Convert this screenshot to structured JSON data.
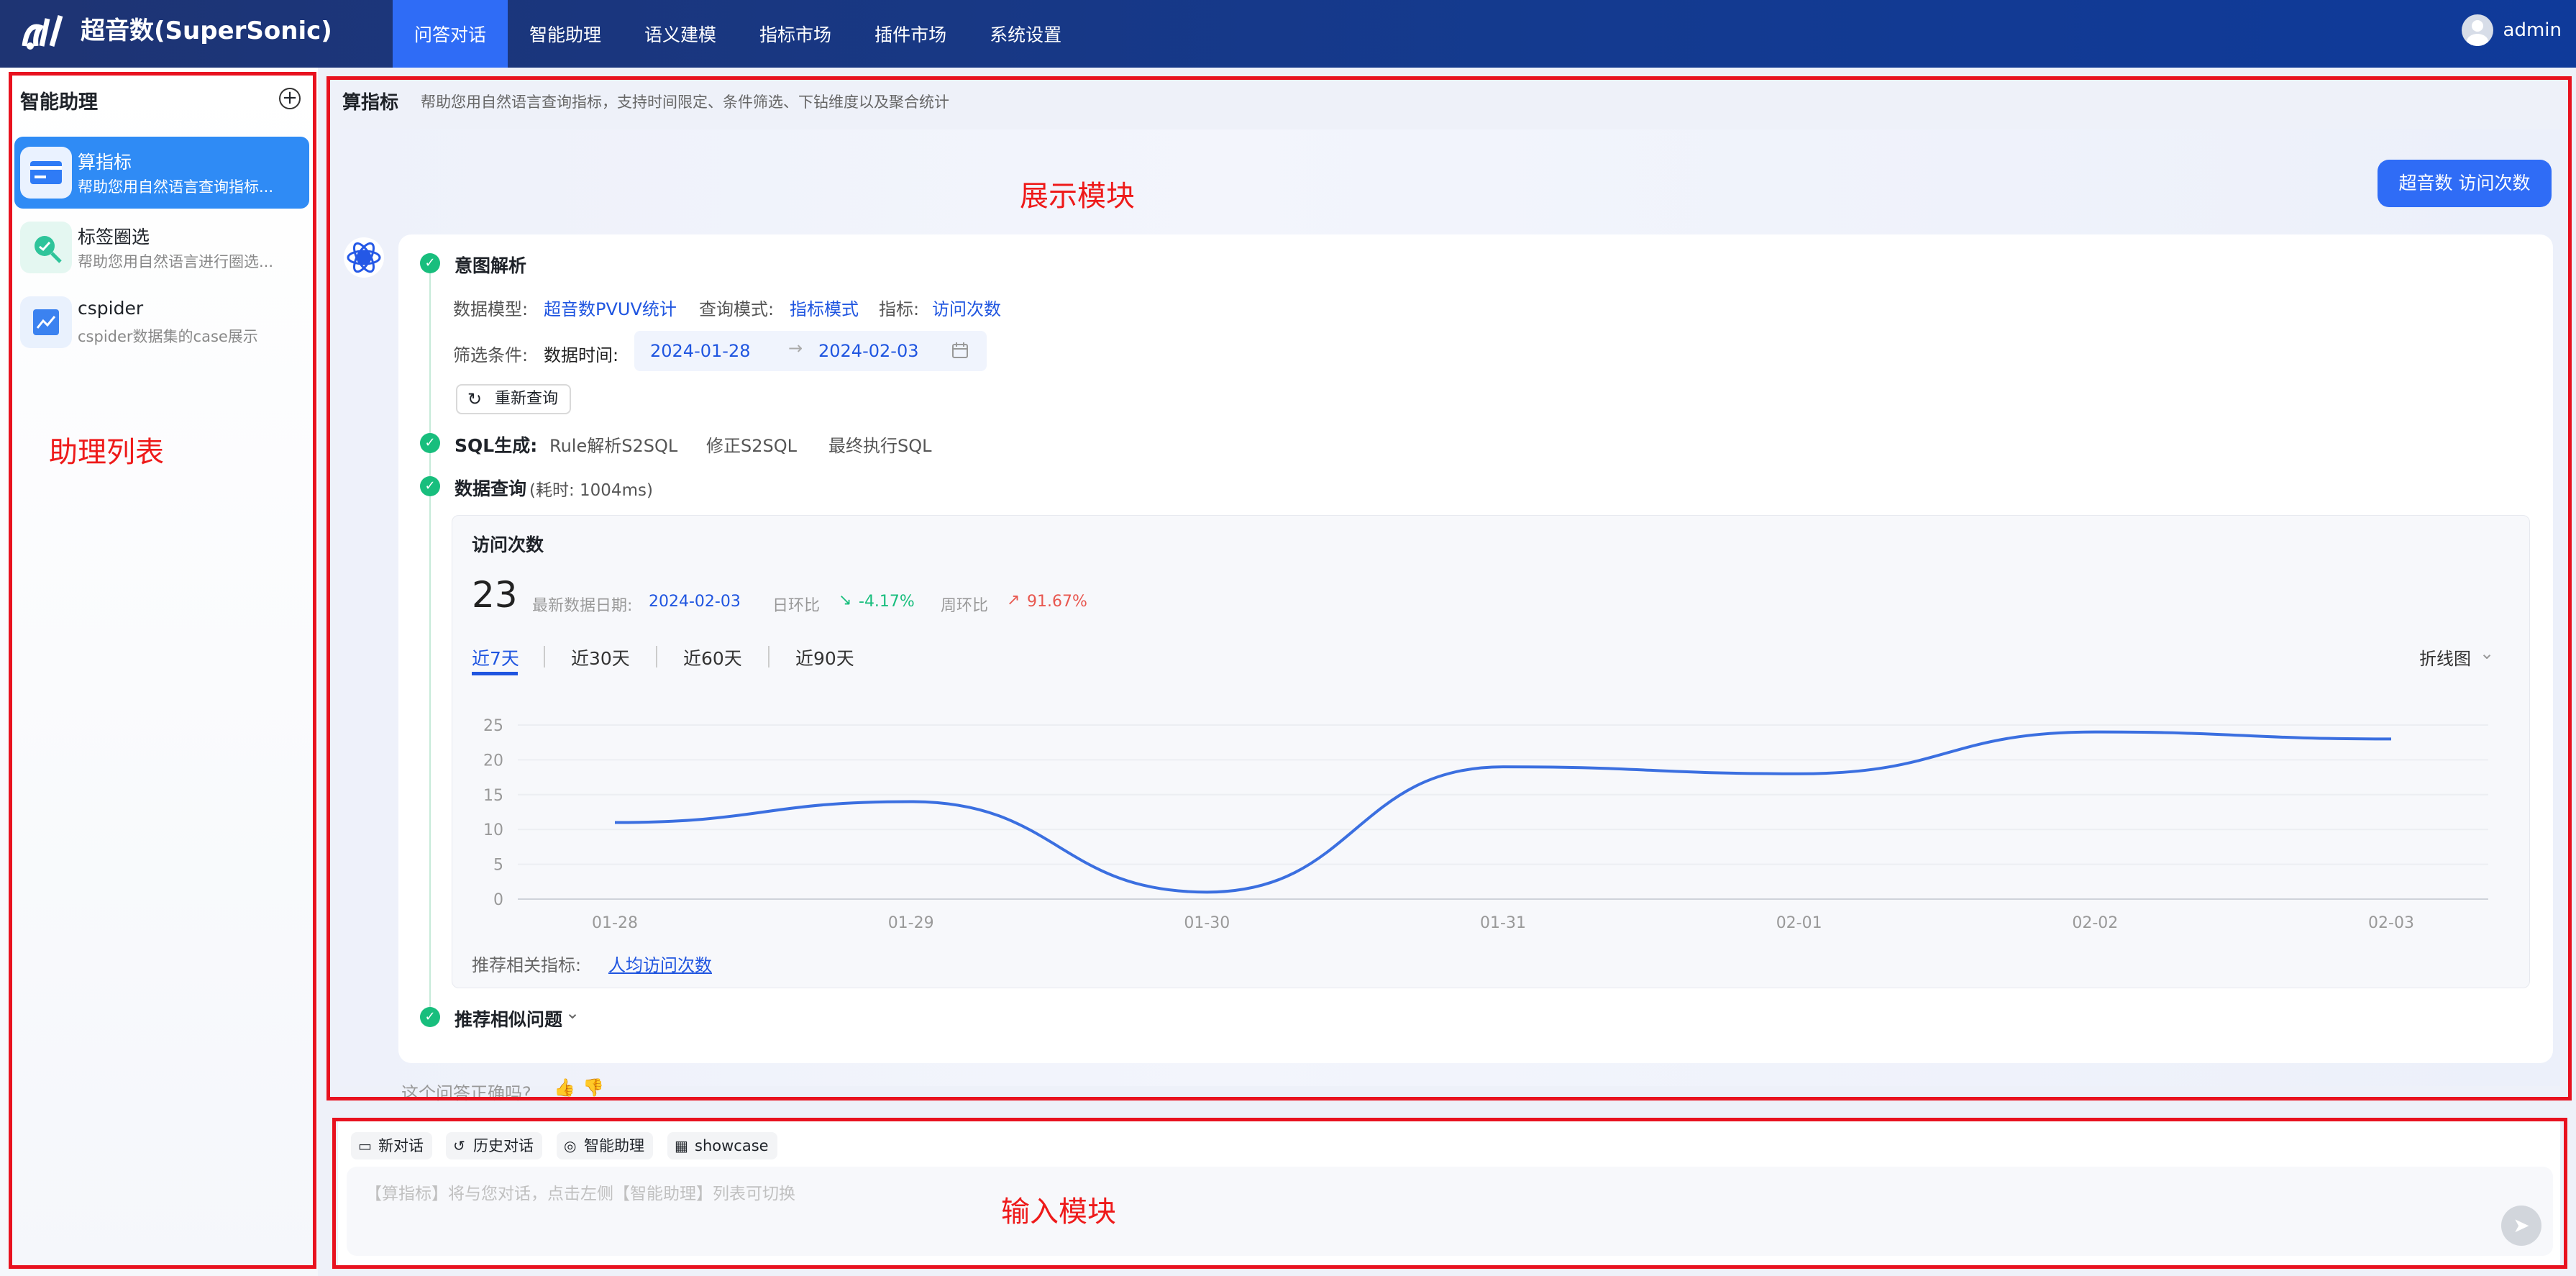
{
  "brand": "超音数(SuperSonic)",
  "nav": [
    "问答对话",
    "智能助理",
    "语义建模",
    "指标市场",
    "插件市场",
    "系统设置"
  ],
  "user": "admin",
  "sidebar": {
    "title": "智能助理",
    "agents": [
      {
        "name": "算指标",
        "desc": "帮助您用自然语言查询指标..."
      },
      {
        "name": "标签圈选",
        "desc": "帮助您用自然语言进行圈选..."
      },
      {
        "name": "cspider",
        "desc": "cspider数据集的case展示"
      }
    ]
  },
  "annotations": {
    "list": "助理列表",
    "display": "展示模块",
    "input": "输入模块"
  },
  "header": {
    "title": "算指标",
    "desc": "帮助您用自然语言查询指标，支持时间限定、条件筛选、下钻维度以及聚合统计"
  },
  "top_button": "超音数 访问次数",
  "intent": {
    "title": "意图解析",
    "model_label": "数据模型:",
    "model": "超音数PVUV统计",
    "mode_label": "查询模式:",
    "mode": "指标模式",
    "metric_label": "指标:",
    "metric": "访问次数",
    "filter_label": "筛选条件:",
    "time_label": "数据时间:",
    "date_start": "2024-01-28",
    "date_end": "2024-02-03",
    "refresh": "重新查询"
  },
  "sql": {
    "title": "SQL生成:",
    "items": [
      "Rule解析S2SQL",
      "修正S2SQL",
      "最终执行SQL"
    ]
  },
  "query": {
    "title": "数据查询",
    "time": "(耗时: 1004ms)"
  },
  "metric_card": {
    "title": "访问次数",
    "value": "23",
    "date_label": "最新数据日期:",
    "date": "2024-02-03",
    "day_label": "日环比",
    "day_change": "-4.17%",
    "week_label": "周环比",
    "week_change": "91.67%",
    "tabs": [
      "近7天",
      "近30天",
      "近60天",
      "近90天"
    ],
    "chart_type": "折线图",
    "related_label": "推荐相关指标:",
    "related": "人均访问次数"
  },
  "similar": "推荐相似问题",
  "feedback": "这个问答正确吗?",
  "chips": [
    "新对话",
    "历史对话",
    "智能助理",
    "showcase"
  ],
  "input_placeholder": "【算指标】将与您对话，点击左侧【智能助理】列表可切换",
  "colors": {
    "accent": "#2f6cf6",
    "line": "#3b6fe0",
    "up": "#e8574f",
    "down": "#18be7d"
  },
  "chart_data": {
    "type": "line",
    "categories": [
      "01-28",
      "01-29",
      "01-30",
      "01-31",
      "02-01",
      "02-02",
      "02-03"
    ],
    "values": [
      11,
      14,
      1,
      19,
      18,
      24,
      23
    ],
    "ylim": [
      0,
      25
    ],
    "yticks": [
      0,
      5,
      10,
      15,
      20,
      25
    ]
  }
}
